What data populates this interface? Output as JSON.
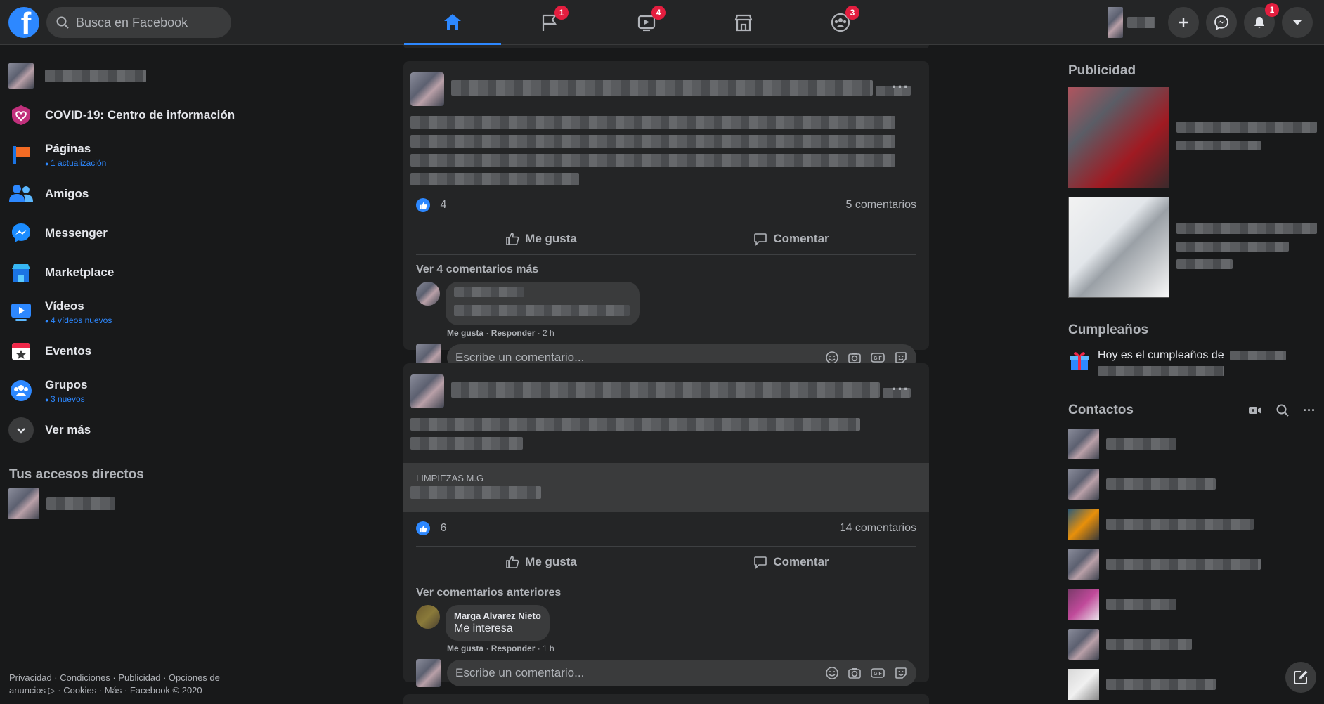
{
  "search": {
    "placeholder": "Busca en Facebook"
  },
  "nav": {
    "badges": {
      "pages": "1",
      "watch": "4",
      "groups": "3"
    }
  },
  "header": {
    "notifications_badge": "1"
  },
  "leftnav": {
    "items": [
      {
        "label": "COVID-19: Centro de información",
        "sub": ""
      },
      {
        "label": "Páginas",
        "sub": "1 actualización"
      },
      {
        "label": "Amigos",
        "sub": ""
      },
      {
        "label": "Messenger",
        "sub": ""
      },
      {
        "label": "Marketplace",
        "sub": ""
      },
      {
        "label": "Vídeos",
        "sub": "4 vídeos nuevos"
      },
      {
        "label": "Eventos",
        "sub": ""
      },
      {
        "label": "Grupos",
        "sub": "3 nuevos"
      },
      {
        "label": "Ver más",
        "sub": ""
      }
    ],
    "shortcuts_title": "Tus accesos directos"
  },
  "footer": {
    "text": "Privacidad · Condiciones · Publicidad · Opciones de anuncios ▷ · Cookies · Más · Facebook © 2020"
  },
  "posts": [
    {
      "likes": "4",
      "comments": "5 comentarios",
      "like_label": "Me gusta",
      "comment_label": "Comentar",
      "more_comments": "Ver 4 comentarios más",
      "comment": {
        "name": "",
        "text": "",
        "meta_like": "Me gusta",
        "meta_reply": "Responder",
        "meta_time": "2 h"
      },
      "write_placeholder": "Escribe un comentario..."
    },
    {
      "link_domain": "LIMPIEZAS M.G",
      "likes": "6",
      "comments": "14 comentarios",
      "like_label": "Me gusta",
      "comment_label": "Comentar",
      "more_comments": "Ver comentarios anteriores",
      "comment": {
        "name": "Marga Alvarez Nieto",
        "text": "Me interesa",
        "meta_like": "Me gusta",
        "meta_reply": "Responder",
        "meta_time": "1 h"
      },
      "write_placeholder": "Escribe un comentario..."
    }
  ],
  "rightcol": {
    "ads_title": "Publicidad",
    "birthdays_title": "Cumpleaños",
    "birthday_text": "Hoy es el cumpleaños de",
    "contacts_title": "Contactos"
  }
}
